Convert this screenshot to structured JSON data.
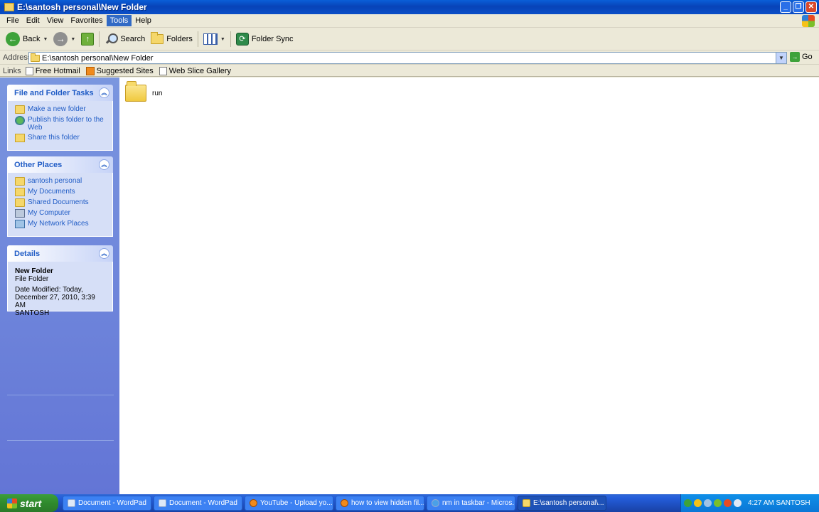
{
  "window": {
    "title": "E:\\santosh personal\\New Folder"
  },
  "menu": [
    "File",
    "Edit",
    "View",
    "Favorites",
    "Tools",
    "Help"
  ],
  "menu_active": "Tools",
  "toolbar": {
    "back": "Back",
    "search": "Search",
    "folders": "Folders",
    "folder_sync": "Folder Sync"
  },
  "address": {
    "label": "Address",
    "value": "E:\\santosh personal\\New Folder",
    "go": "Go"
  },
  "links": {
    "label": "Links",
    "items": [
      "Free Hotmail",
      "Suggested Sites",
      "Web Slice Gallery"
    ]
  },
  "panels": {
    "file_tasks": {
      "title": "File and Folder Tasks",
      "items": [
        "Make a new folder",
        "Publish this folder to the Web",
        "Share this folder"
      ]
    },
    "other_places": {
      "title": "Other Places",
      "items": [
        "santosh personal",
        "My Documents",
        "Shared Documents",
        "My Computer",
        "My Network Places"
      ]
    },
    "details": {
      "title": "Details",
      "name": "New Folder",
      "type": "File Folder",
      "modified": "Date Modified: Today, December 27, 2010, 3:39 AM",
      "owner": "SANTOSH"
    }
  },
  "files": [
    {
      "name": "run",
      "icon": "folder-icon"
    }
  ],
  "taskbar": {
    "start": "start",
    "buttons": [
      {
        "label": "Document - WordPad",
        "icon": "wordpad-icon"
      },
      {
        "label": "Document - WordPad",
        "icon": "wordpad-icon"
      },
      {
        "label": "YouTube - Upload yo...",
        "icon": "firefox-icon"
      },
      {
        "label": "how to view hidden fil...",
        "icon": "firefox-icon"
      },
      {
        "label": "nm in taskbar - Micros...",
        "icon": "ie-icon"
      },
      {
        "label": "E:\\santosh personal\\...",
        "icon": "folder-icon"
      }
    ],
    "clock": "4:27 AM SANTOSH"
  },
  "colors": {
    "titlebar": "#0843b8",
    "pane_blue": "#6375d6",
    "link_blue": "#215dc6",
    "menu_highlight": "#316ac5"
  }
}
